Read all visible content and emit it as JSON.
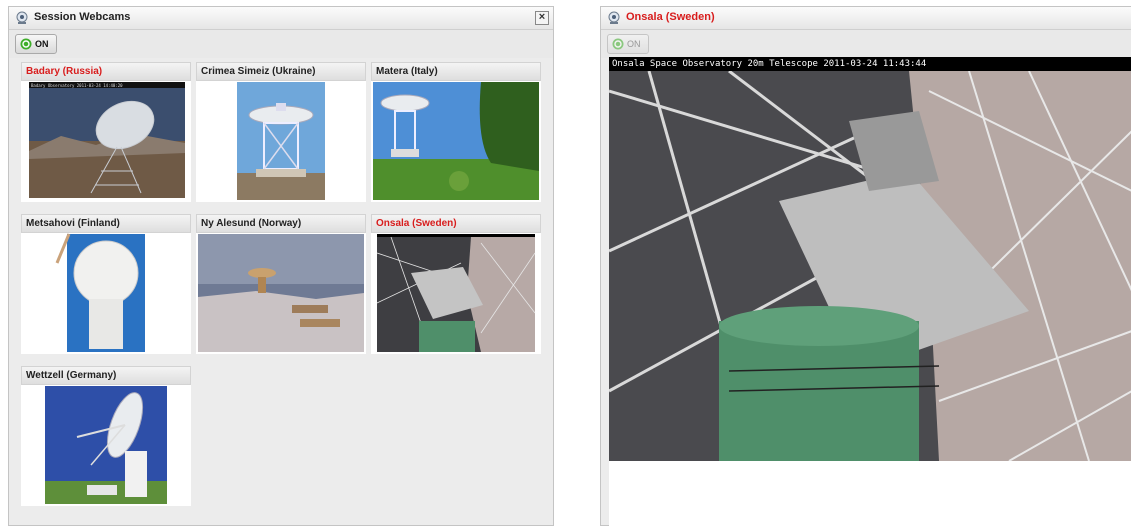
{
  "left_panel": {
    "title": "Session Webcams",
    "close_label": "×",
    "on_button": "ON",
    "cameras": [
      {
        "label": "Badary (Russia)",
        "active": true,
        "overlay": "Badary Observatory 2011-03-24 14:40:20"
      },
      {
        "label": "Crimea Simeiz (Ukraine)",
        "active": false
      },
      {
        "label": "Matera (Italy)",
        "active": false
      },
      {
        "label": "Metsahovi (Finland)",
        "active": false
      },
      {
        "label": "Ny Alesund (Norway)",
        "active": false
      },
      {
        "label": "Onsala (Sweden)",
        "active": true
      },
      {
        "label": "Wettzell (Germany)",
        "active": false
      }
    ]
  },
  "right_panel": {
    "title": "Onsala (Sweden)",
    "on_button": "ON",
    "overlay": "Onsala Space Observatory 20m Telescope  2011-03-24 11:43:44"
  },
  "colors": {
    "active_title": "#d81d1d",
    "panel_bg": "#ececec",
    "on_green": "#3fae2a"
  }
}
